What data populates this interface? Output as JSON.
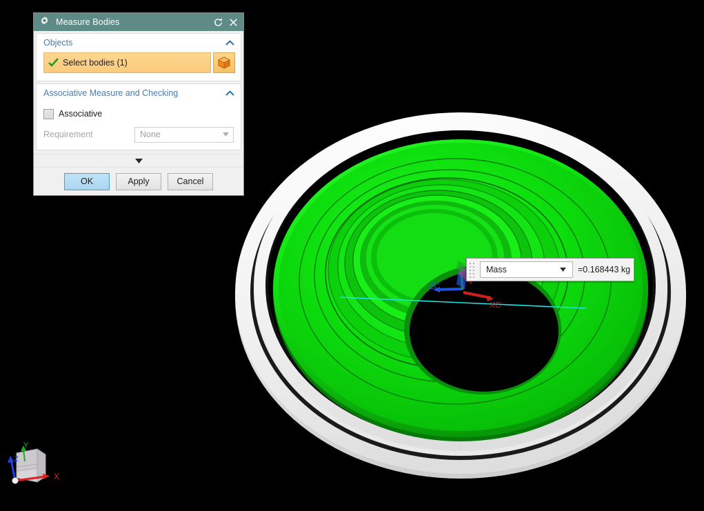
{
  "app": {
    "viewport_background": "#000000"
  },
  "dialog": {
    "title": "Measure Bodies",
    "icons": {
      "title_icon": "gear-icon",
      "reset_icon": "reset-icon",
      "close_icon": "close-icon"
    },
    "colors": {
      "titlebar": "#5F8B87",
      "section_label": "#4C7BA6",
      "select_field": "#FBD086",
      "primary_button": "#A9D8F2"
    },
    "sections": [
      {
        "label": "Objects",
        "collapse_state": "expanded",
        "select_body": {
          "label": "Select bodies (1)",
          "status_icon": "check-icon",
          "action_icon": "cube-icon"
        }
      },
      {
        "label": "Associative Measure and Checking",
        "collapse_state": "expanded",
        "checkbox": {
          "label": "Associative",
          "checked": false
        },
        "requirement": {
          "label": "Requirement",
          "value": "None",
          "enabled": false
        }
      }
    ],
    "more_options_label": "",
    "buttons": [
      {
        "label": "OK",
        "primary": true
      },
      {
        "label": "Apply",
        "primary": false
      },
      {
        "label": "Cancel",
        "primary": false
      }
    ]
  },
  "measurement": {
    "type": "Mass",
    "value": "=0.168443 kg"
  },
  "viewport": {
    "axis_labels": {
      "x": "XC",
      "z": "ZC"
    },
    "orientation_triad": {
      "x": "X",
      "y": "Y",
      "z": "Z"
    },
    "model_colors": {
      "selected_body": "#0CE00C",
      "outer_ring": "#F2F2F2",
      "x_axis": "#CC2020",
      "z_axis": "#2255DD",
      "datum_line": "#23E0E0"
    }
  }
}
